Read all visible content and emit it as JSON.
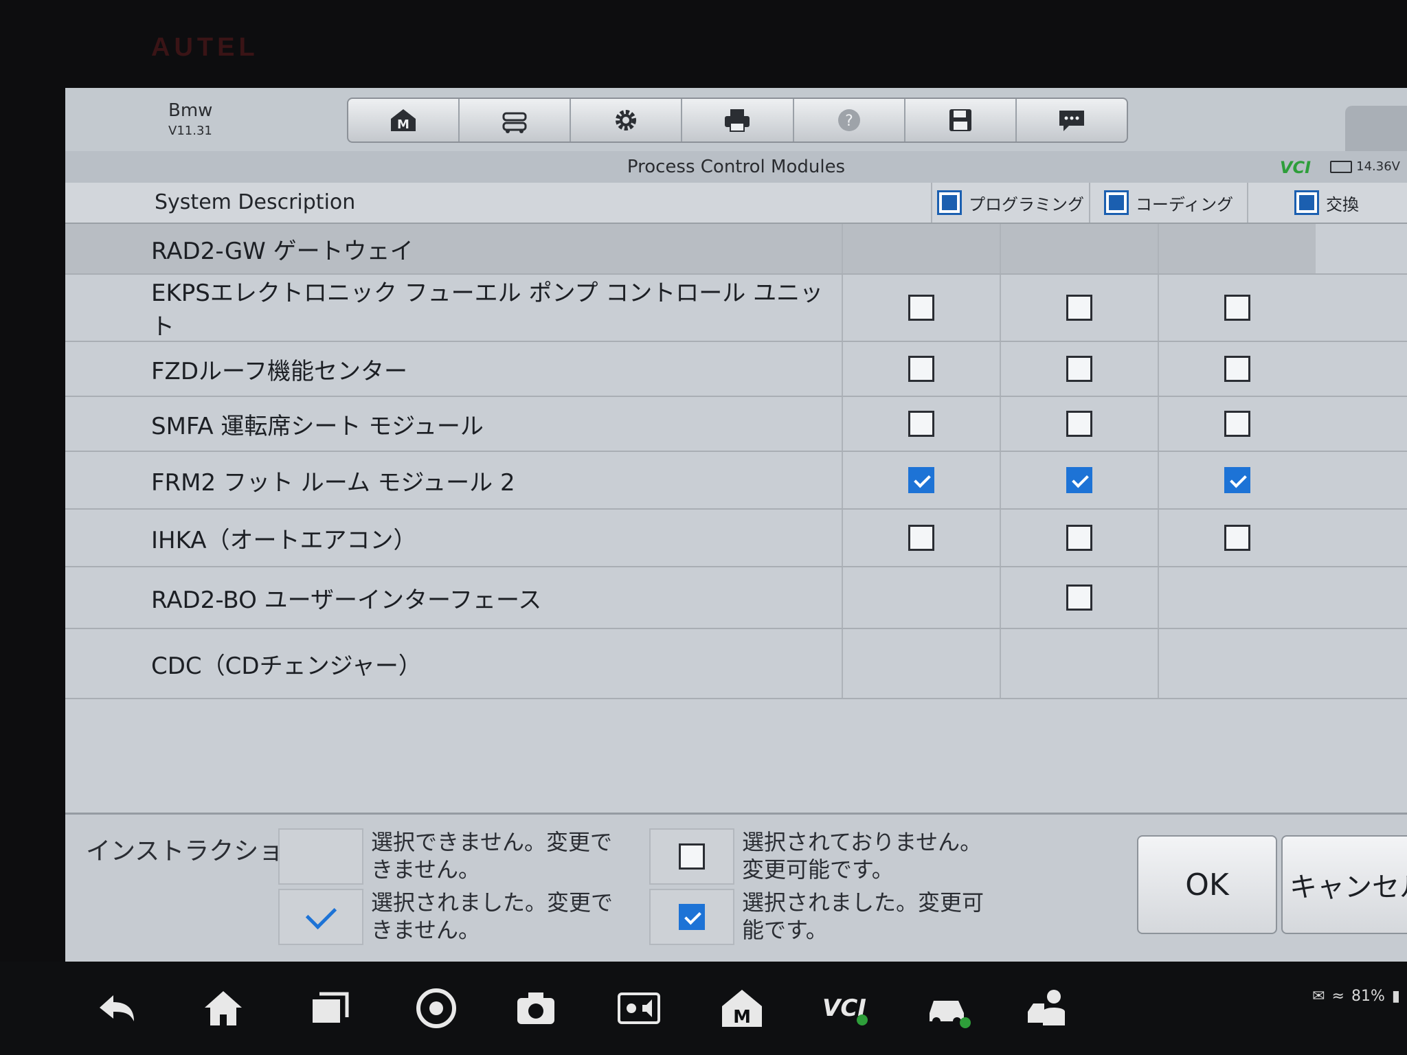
{
  "bezel": {
    "brand": "AUTEL"
  },
  "header": {
    "app_name": "Bmw",
    "version": "V11.31",
    "toolbar_icons": [
      "home-m-icon",
      "vehicle-lift-icon",
      "gear-icon",
      "printer-icon",
      "help-icon",
      "save-icon",
      "message-icon"
    ],
    "subtitle": "Process Control Modules",
    "vci_label": "VCI",
    "battery": "14.36V"
  },
  "table": {
    "desc_header": "System Description",
    "col_headers": [
      "プログラミング",
      "コーディング",
      "交換"
    ],
    "rows": [
      {
        "label": "RAD2-GW ゲートウェイ",
        "cells": [
          "none",
          "none",
          "none"
        ]
      },
      {
        "label": "EKPSエレクトロニック フューエル ポンプ コントロール ユニット",
        "cells": [
          "unchecked",
          "unchecked",
          "unchecked"
        ]
      },
      {
        "label": "FZDルーフ機能センター",
        "cells": [
          "unchecked",
          "unchecked",
          "unchecked"
        ]
      },
      {
        "label": "SMFA 運転席シート モジュール",
        "cells": [
          "unchecked",
          "unchecked",
          "unchecked"
        ]
      },
      {
        "label": "FRM2 フット ルーム モジュール 2",
        "cells": [
          "checked",
          "checked",
          "checked"
        ]
      },
      {
        "label": "IHKA（オートエアコン）",
        "cells": [
          "unchecked",
          "unchecked",
          "unchecked"
        ]
      },
      {
        "label": "RAD2-BO ユーザーインターフェース",
        "cells": [
          "none",
          "unchecked",
          "none"
        ]
      },
      {
        "label": "CDC（CDチェンジャー）",
        "cells": [
          "none",
          "none",
          "none"
        ]
      }
    ]
  },
  "instructions": {
    "label": "インストラクション",
    "legend": [
      "選択できません。変更できません。",
      "選択されました。変更できません。",
      "選択されておりません。変更可能です。",
      "選択されました。変更可能です。"
    ]
  },
  "buttons": {
    "ok": "OK",
    "cancel": "キャンセル"
  },
  "navbar": {
    "icons": [
      "back-icon",
      "home-icon",
      "recent-apps-icon",
      "chrome-icon",
      "camera-icon",
      "brightness-volume-icon",
      "maxisys-icon",
      "vci-icon",
      "vehicle-icon",
      "support-icon"
    ],
    "battery_percent": "81%"
  }
}
